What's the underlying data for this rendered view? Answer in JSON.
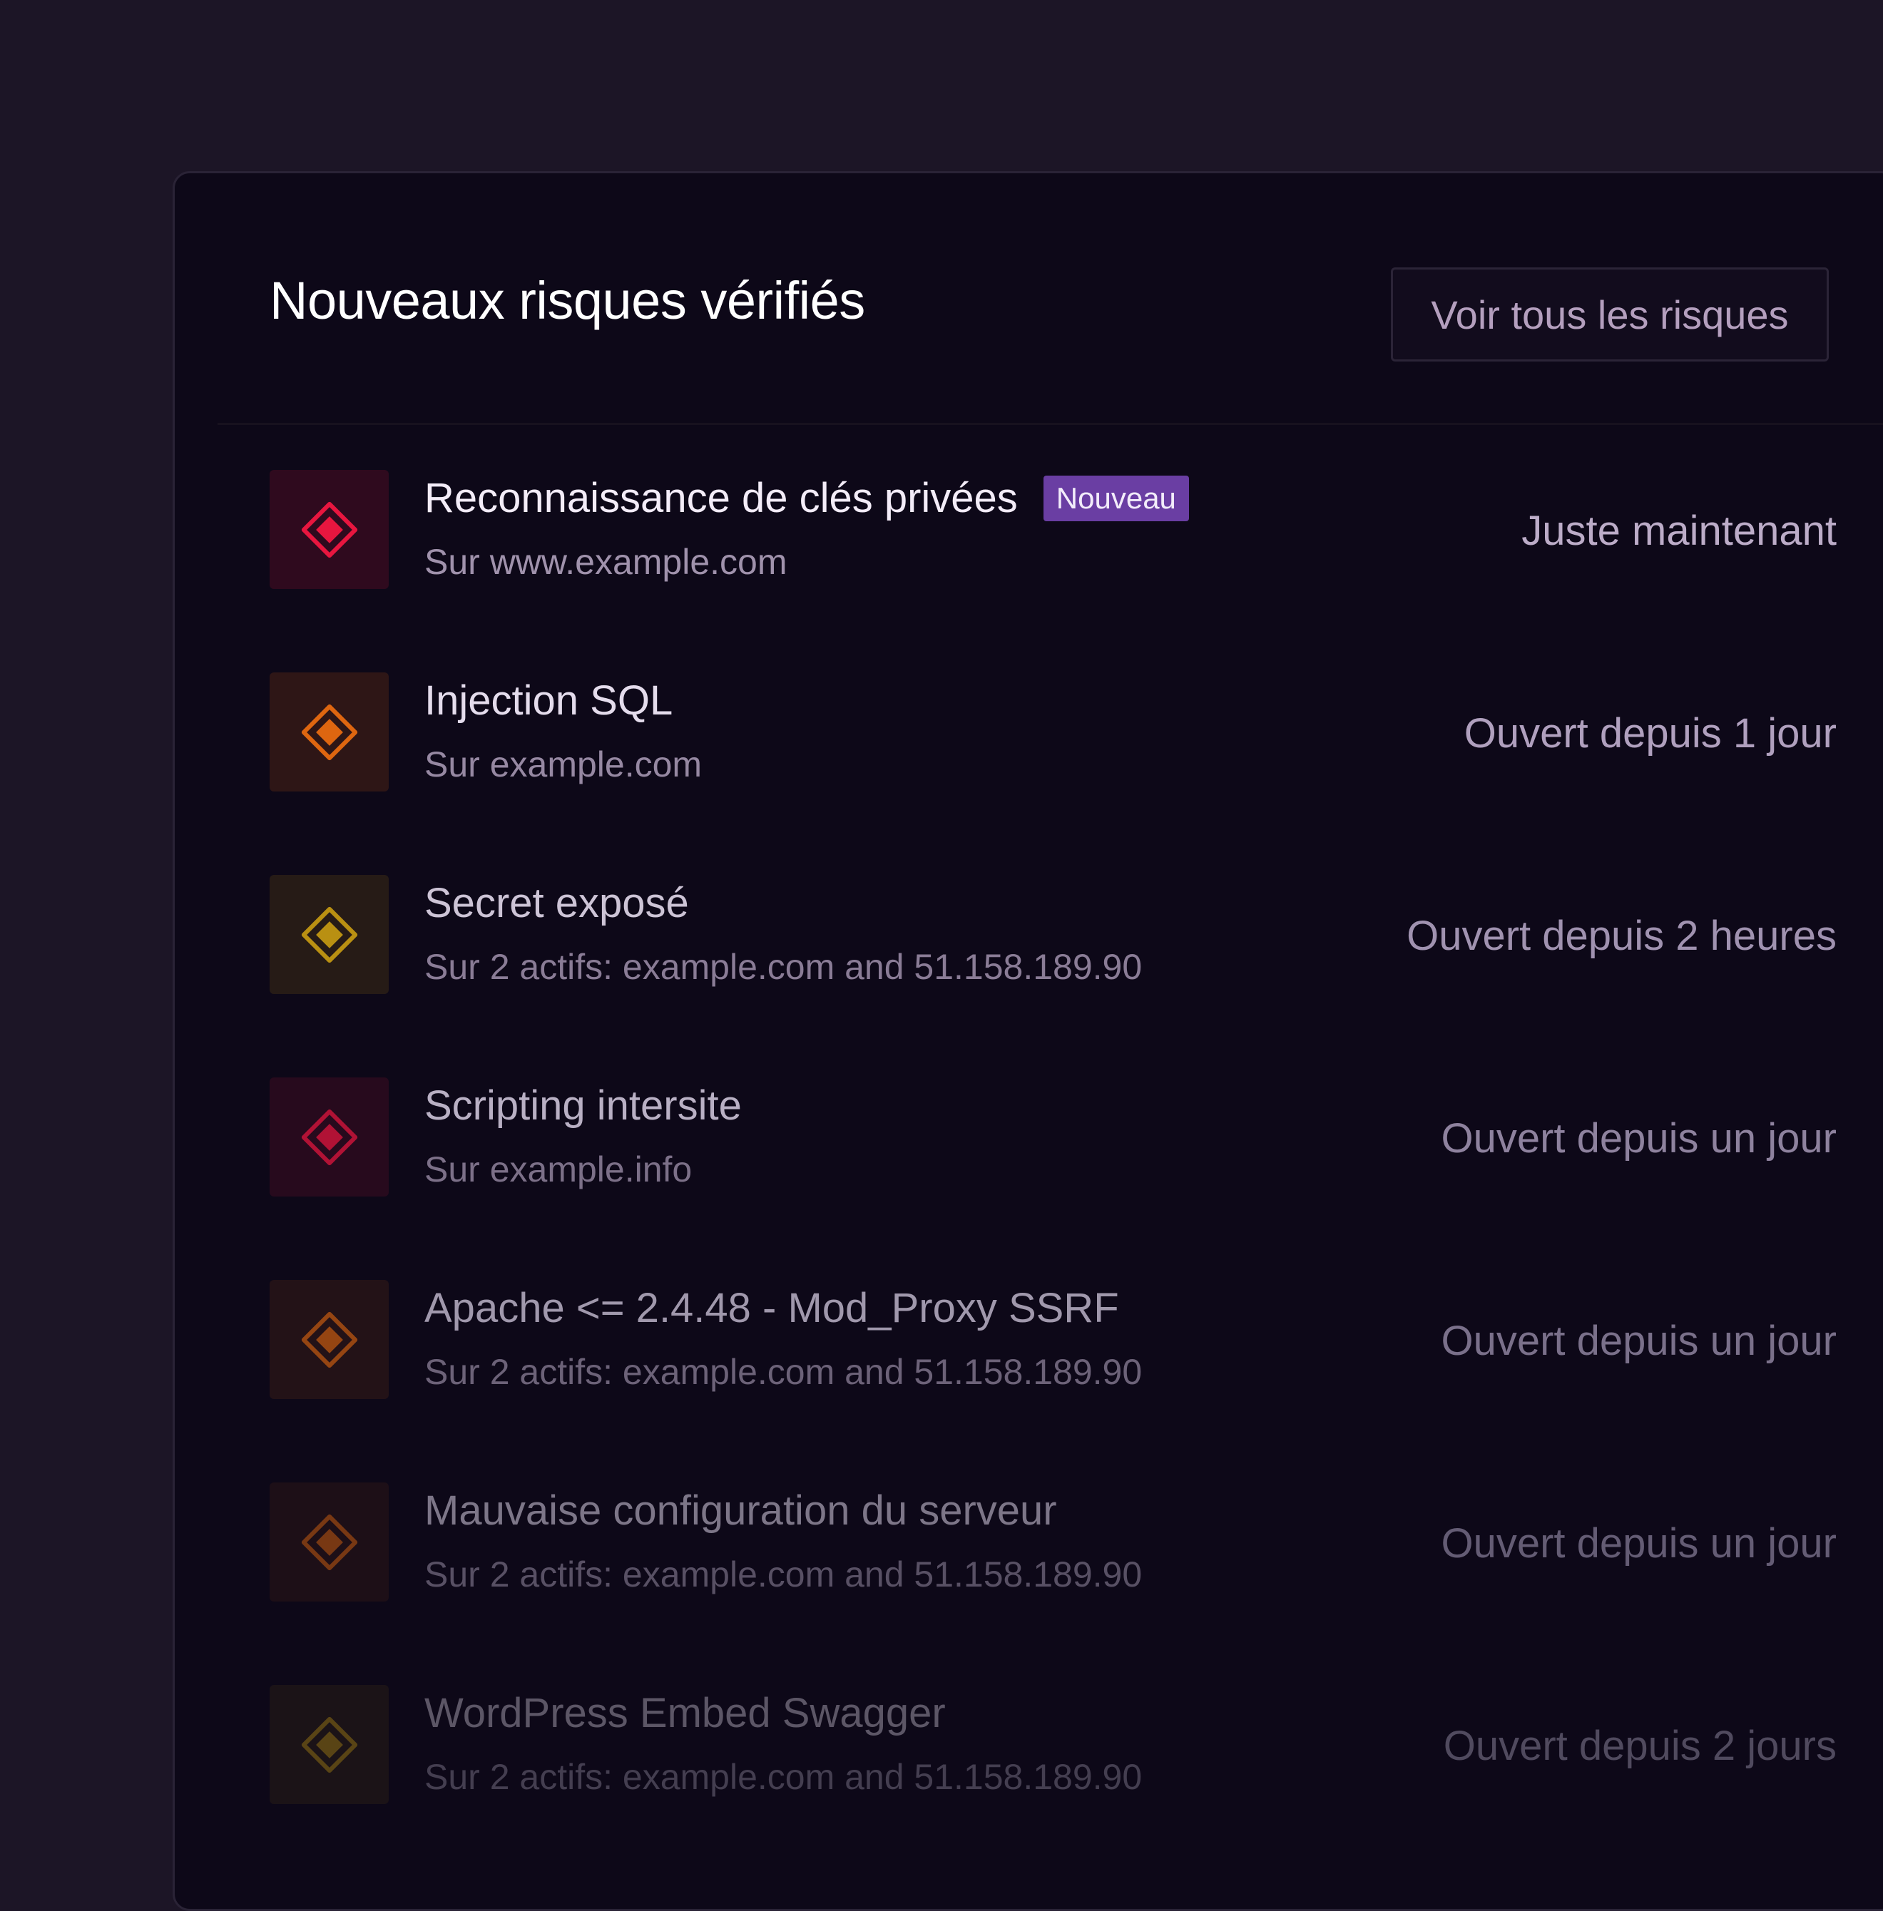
{
  "panel": {
    "title": "Nouveaux risques vérifiés",
    "view_all_label": "Voir tous les risques"
  },
  "colors": {
    "background": "#1c1526",
    "panel": "#0d0818",
    "badge": "#6a3ea3",
    "critical": "#e8163f",
    "high": "#e86a10",
    "medium": "#d4a412"
  },
  "risks": [
    {
      "icon": "diamond-warning-icon",
      "severity": "critical",
      "title": "Reconnaissance de clés privées",
      "badge": "Nouveau",
      "subtitle": "Sur www.example.com",
      "time": "Juste maintenant"
    },
    {
      "icon": "diamond-warning-icon",
      "severity": "high",
      "title": "Injection SQL",
      "subtitle": "Sur example.com",
      "time": "Ouvert depuis 1 jour"
    },
    {
      "icon": "diamond-warning-icon",
      "severity": "medium",
      "title": "Secret exposé",
      "subtitle": "Sur 2 actifs: example.com and 51.158.189.90",
      "time": "Ouvert depuis 2 heures"
    },
    {
      "icon": "diamond-warning-icon",
      "severity": "critical",
      "title": "Scripting intersite",
      "subtitle": "Sur example.info",
      "time": "Ouvert depuis un jour"
    },
    {
      "icon": "diamond-warning-icon",
      "severity": "high",
      "title": "Apache <= 2.4.48 - Mod_Proxy SSRF",
      "subtitle": "Sur 2 actifs: example.com and 51.158.189.90",
      "time": "Ouvert depuis un jour"
    },
    {
      "icon": "diamond-warning-icon",
      "severity": "high",
      "title": "Mauvaise configuration du serveur",
      "subtitle": "Sur 2 actifs: example.com and 51.158.189.90",
      "time": "Ouvert depuis un jour"
    },
    {
      "icon": "diamond-warning-icon",
      "severity": "medium",
      "title": "WordPress Embed Swagger",
      "subtitle": "Sur 2 actifs: example.com and 51.158.189.90",
      "time": "Ouvert depuis 2 jours"
    }
  ]
}
